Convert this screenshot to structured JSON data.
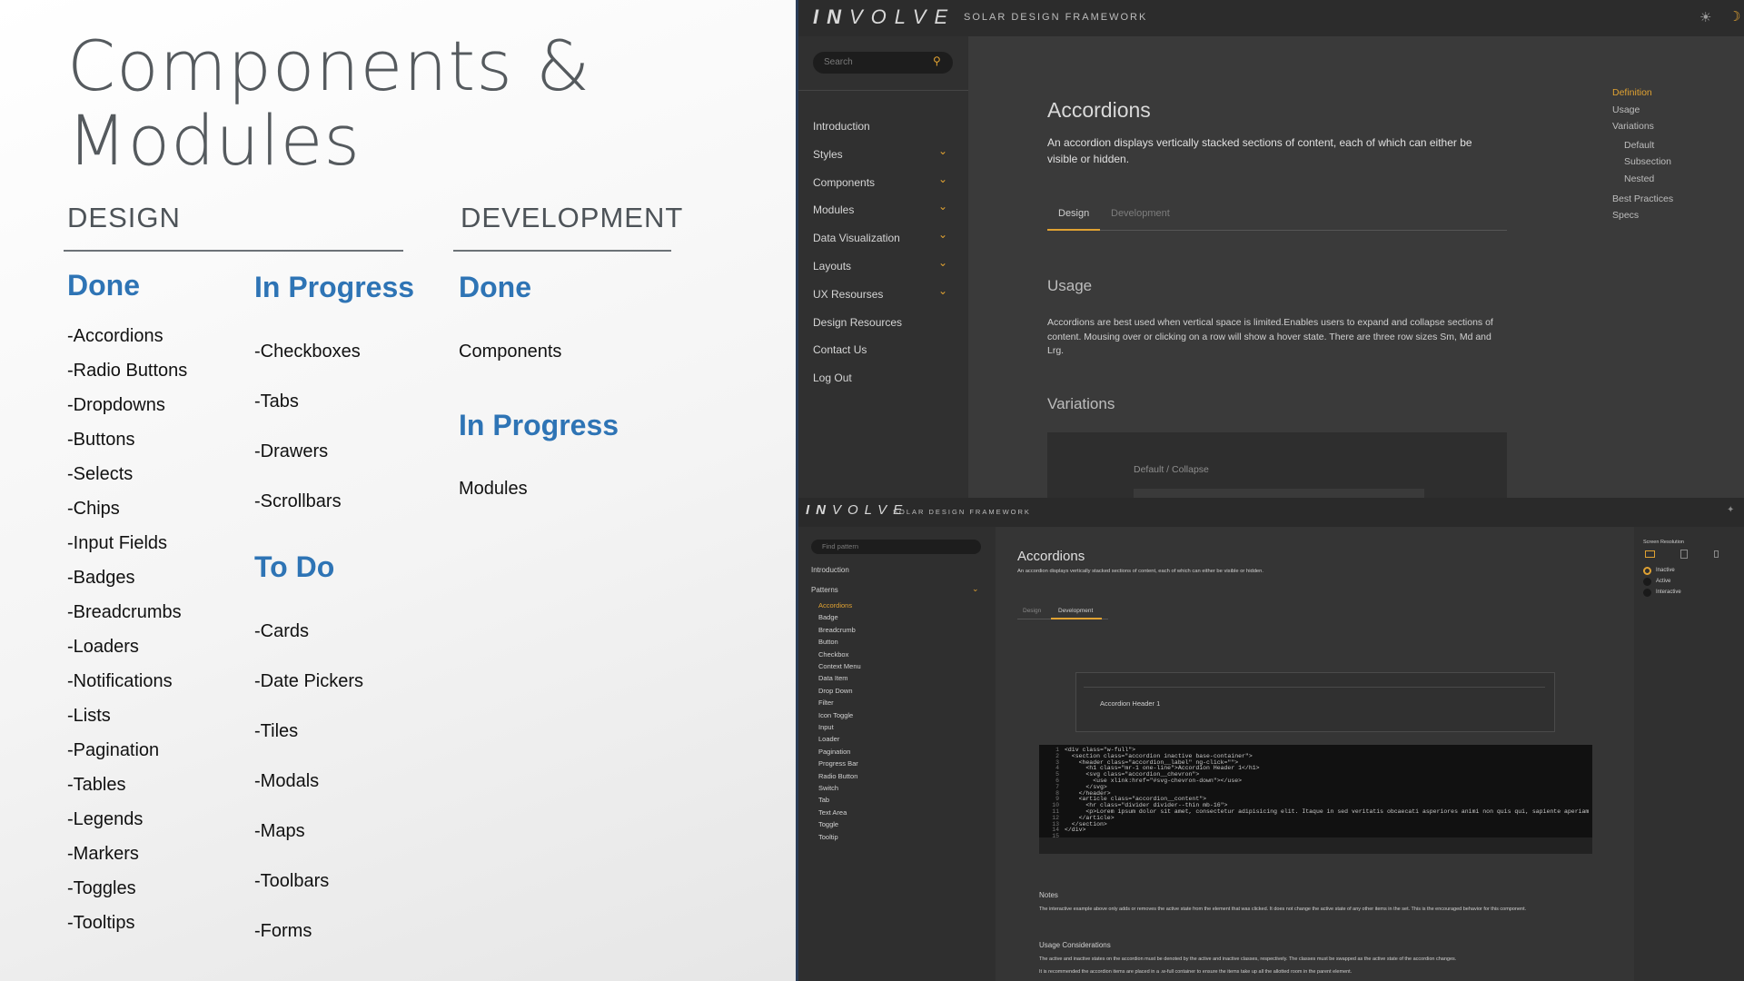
{
  "slide": {
    "title_line1": "Components &",
    "title_line2": "Modules",
    "design": {
      "heading": "DESIGN",
      "done": {
        "heading": "Done",
        "items": [
          "-Accordions",
          "-Radio Buttons",
          "-Dropdowns",
          "-Buttons",
          "-Selects",
          "-Chips",
          "-Input Fields",
          "-Badges",
          "-Breadcrumbs",
          "-Loaders",
          "-Notifications",
          "-Lists",
          "-Pagination",
          "-Tables",
          "-Legends",
          "-Markers",
          "-Toggles",
          "-Tooltips"
        ]
      },
      "in_progress": {
        "heading": "In Progress",
        "items": [
          "-Checkboxes",
          "-Tabs",
          "-Drawers",
          "-Scrollbars"
        ]
      },
      "todo": {
        "heading": "To Do",
        "items": [
          "-Cards",
          "-Date Pickers",
          "-Tiles",
          "-Modals",
          "-Maps",
          "-Toolbars",
          "-Forms"
        ]
      }
    },
    "development": {
      "heading": "DEVELOPMENT",
      "done": {
        "heading": "Done",
        "items": [
          "Components"
        ]
      },
      "in_progress": {
        "heading": "In Progress",
        "items": [
          "Modules"
        ]
      }
    }
  },
  "top_app": {
    "brand_bold": "IN",
    "brand_rest": "VOLVE",
    "subtitle": "SOLAR DESIGN FRAMEWORK",
    "search_placeholder": "Search",
    "nav": [
      {
        "label": "Introduction",
        "chevron": false
      },
      {
        "label": "Styles",
        "chevron": true
      },
      {
        "label": "Components",
        "chevron": true
      },
      {
        "label": "Modules",
        "chevron": true
      },
      {
        "label": "Data Visualization",
        "chevron": true
      },
      {
        "label": "Layouts",
        "chevron": true
      },
      {
        "label": "UX Resourses",
        "chevron": true
      },
      {
        "label": "Design Resources",
        "chevron": false
      },
      {
        "label": "Contact Us",
        "chevron": false
      },
      {
        "label": "Log Out",
        "chevron": false
      }
    ],
    "page_title": "Accordions",
    "description": "An accordion displays vertically stacked sections of content, each of which can either be visible or hidden.",
    "tabs": [
      "Design",
      "Development"
    ],
    "usage_heading": "Usage",
    "usage_text": "Accordions are best used when vertical space is limited.Enables users to expand and collapse sections of content. Mousing over or clicking on a row will show a hover state. There are three row sizes Sm, Md and Lrg.",
    "variations_heading": "Variations",
    "variation_label": "Default / Collapse",
    "toc": [
      "Definition",
      "Usage",
      "Variations",
      "Default",
      "Subsection",
      "Nested",
      "Best Practices",
      "Specs"
    ]
  },
  "bottom_app": {
    "brand_bold": "IN",
    "brand_rest": "VOLVE",
    "subtitle": "SOLAR DESIGN FRAMEWORK",
    "search_placeholder": "Find pattern",
    "intro": "Introduction",
    "patterns_label": "Patterns",
    "patterns": [
      "Accordions",
      "Badge",
      "Breadcrumb",
      "Button",
      "Checkbox",
      "Context Menu",
      "Data Item",
      "Drop Down",
      "Filter",
      "Icon Toggle",
      "Input",
      "Loader",
      "Pagination",
      "Progress Bar",
      "Radio Button",
      "Switch",
      "Tab",
      "Text Area",
      "Toggle",
      "Tooltip"
    ],
    "page_title": "Accordions",
    "description": "An accordion displays vertically stacked sections of content, each of which can either be visible or hidden.",
    "tabs": [
      "Design",
      "Development"
    ],
    "accordion_header": "Accordion Header 1",
    "code_lines": [
      "<div class=\"w-full\">",
      "  <section class=\"accordion inactive base-container\">",
      "    <header class=\"accordion__label\" ng-click=\"\">",
      "      <h1 class=\"mr-1 one-line\">Accordion Header 1</h1>",
      "      <svg class=\"accordion__chevron\">",
      "        <use xlink:href=\"#svg-chevron-down\"></use>",
      "      </svg>",
      "    </header>",
      "    <article class=\"accordion__content\">",
      "      <hr class=\"divider divider--thin mb-16\">",
      "      <p>Lorem ipsum dolor sit amet, consectetur adipisicing elit. Itaque in sed veritatis obcaecati asperiores animi non quis qui, sapiente aperiam fuga accusanda iure natus</p>",
      "    </article>",
      "  </section>",
      "</div>",
      ""
    ],
    "notes_heading": "Notes",
    "notes_text": "The interactive example above only adds or removes the active state from the element that was clicked. It does not change the active state of any other items in the set. This is the encouraged behavior for this component.",
    "usage_heading": "Usage Considerations",
    "usage_text1": "The active and inactive states on the accordion must be denoted by the active and inactive classes, respectively. The classes must be swapped as the active state of the accordion changes.",
    "usage_text2": "It is recommended the accordion items are placed in a .w-full container to ensure the items take up all the allotted room in the parent element.",
    "screen_resolution_label": "Screen Resolution",
    "states": [
      "Inactive",
      "Active",
      "Interactive"
    ]
  },
  "colors": {
    "accent_blue": "#2e74b5",
    "accent_gold": "#e0a232"
  }
}
